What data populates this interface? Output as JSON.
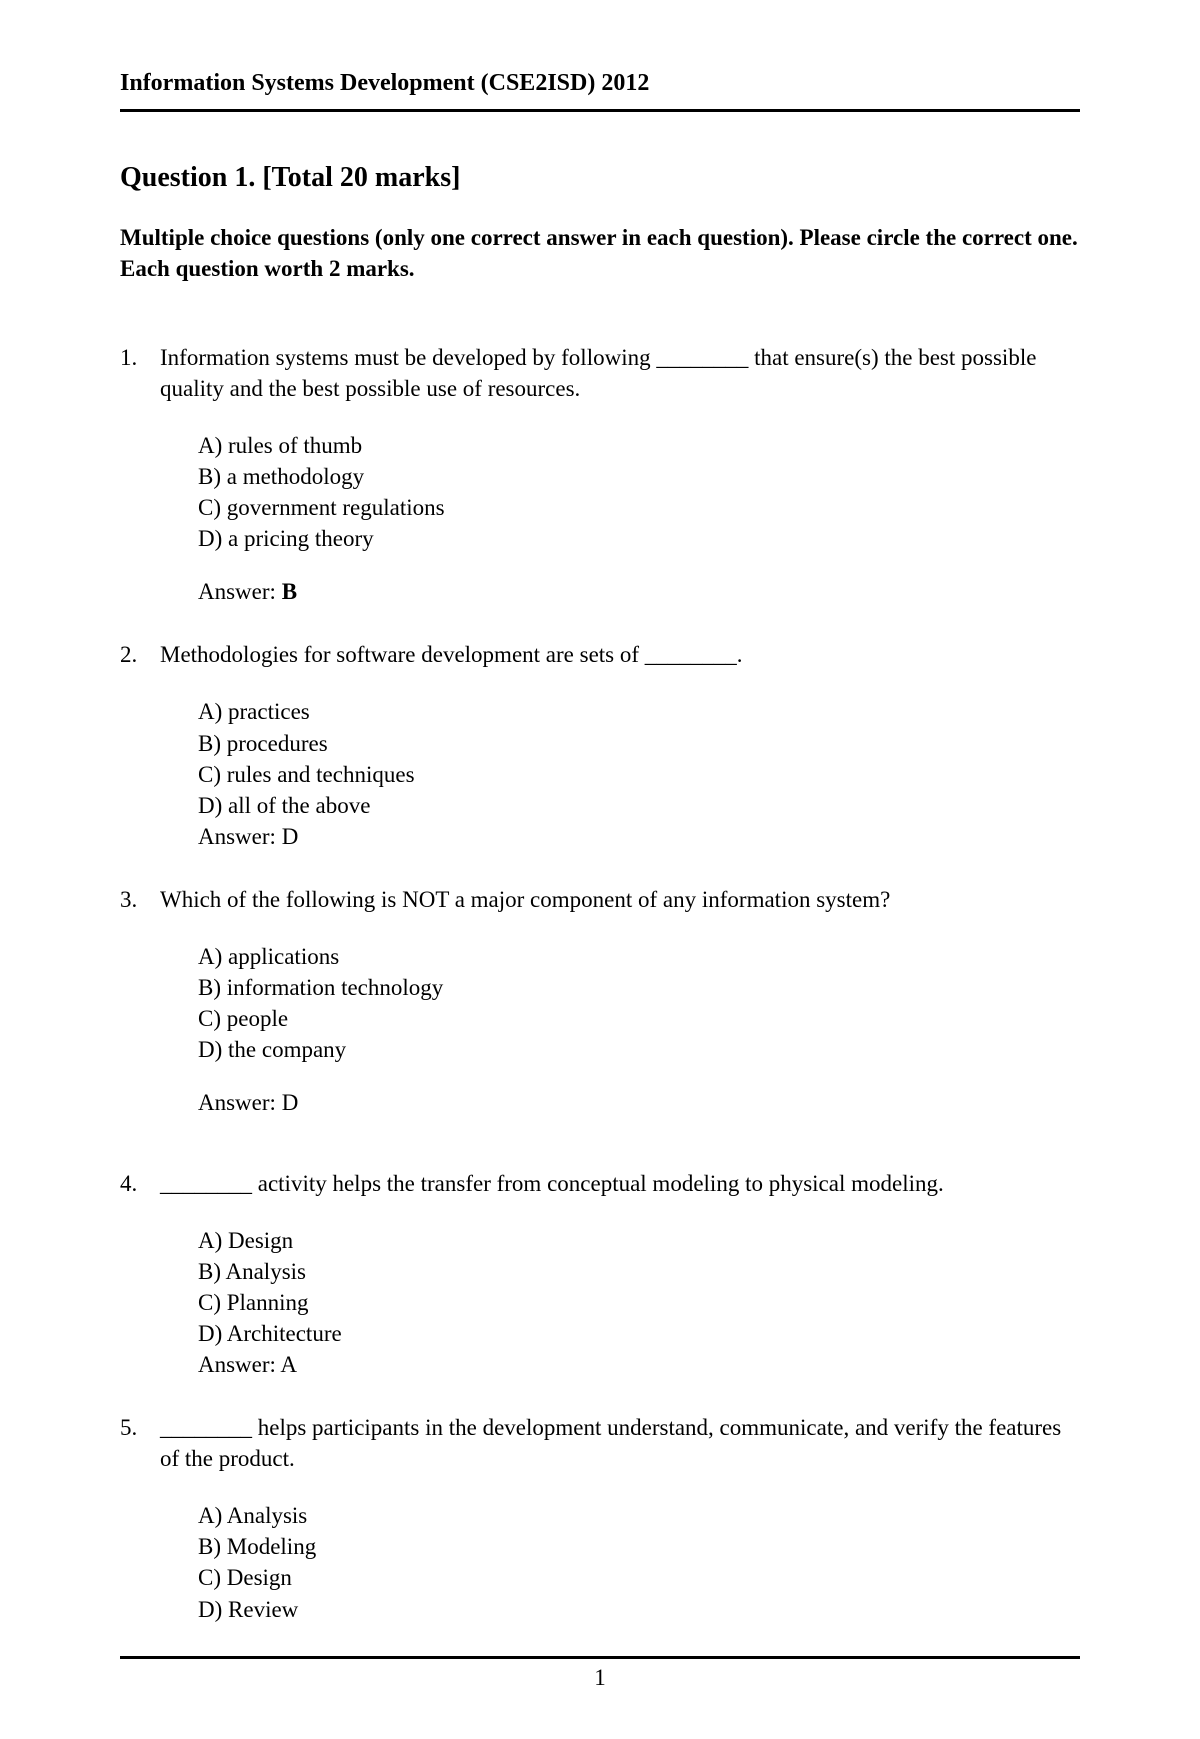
{
  "header": {
    "title": "Information Systems Development (CSE2ISD) 2012"
  },
  "question_heading": "Question 1.  [Total 20 marks]",
  "instructions": "Multiple choice questions (only one correct answer in each question). Please circle the correct one.  Each question worth 2 marks.",
  "questions": [
    {
      "num": "1.",
      "prompt": "Information systems must be developed by following ________ that ensure(s) the best possible quality and the best possible use of resources.",
      "choices": [
        "A) rules of thumb",
        "B) a methodology",
        "C) government regulations",
        "D) a pricing theory"
      ],
      "answer_prefix": "Answer:  ",
      "answer": "B",
      "answer_bold": true,
      "inline_answer": false
    },
    {
      "num": "2.",
      "prompt": "Methodologies for software development are sets of ________.",
      "choices": [
        "A) practices",
        "B) procedures",
        "C) rules and techniques",
        "D) all of the above"
      ],
      "answer_prefix": "Answer:  ",
      "answer": "D",
      "answer_bold": false,
      "inline_answer": true
    },
    {
      "num": "3.",
      "prompt": "Which of the following is NOT a major component of any information system?",
      "choices": [
        "A) applications",
        "B) information technology",
        "C) people",
        "D) the company"
      ],
      "answer_prefix": "Answer:  ",
      "answer": "D",
      "answer_bold": false,
      "inline_answer": false
    },
    {
      "num": "4.",
      "prompt": "________ activity helps the transfer from conceptual modeling to physical modeling.",
      "choices": [
        "A) Design",
        "B) Analysis",
        "C) Planning",
        "D) Architecture"
      ],
      "answer_prefix": "Answer:  ",
      "answer": "A",
      "answer_bold": false,
      "inline_answer": true
    },
    {
      "num": "5.",
      "prompt": "________ helps participants in the development understand, communicate, and verify the features of the product.",
      "choices": [
        "A) Analysis",
        "B) Modeling",
        "C) Design",
        "D) Review"
      ],
      "answer_prefix": "",
      "answer": "",
      "answer_bold": false,
      "inline_answer": false
    }
  ],
  "page_number": "1"
}
